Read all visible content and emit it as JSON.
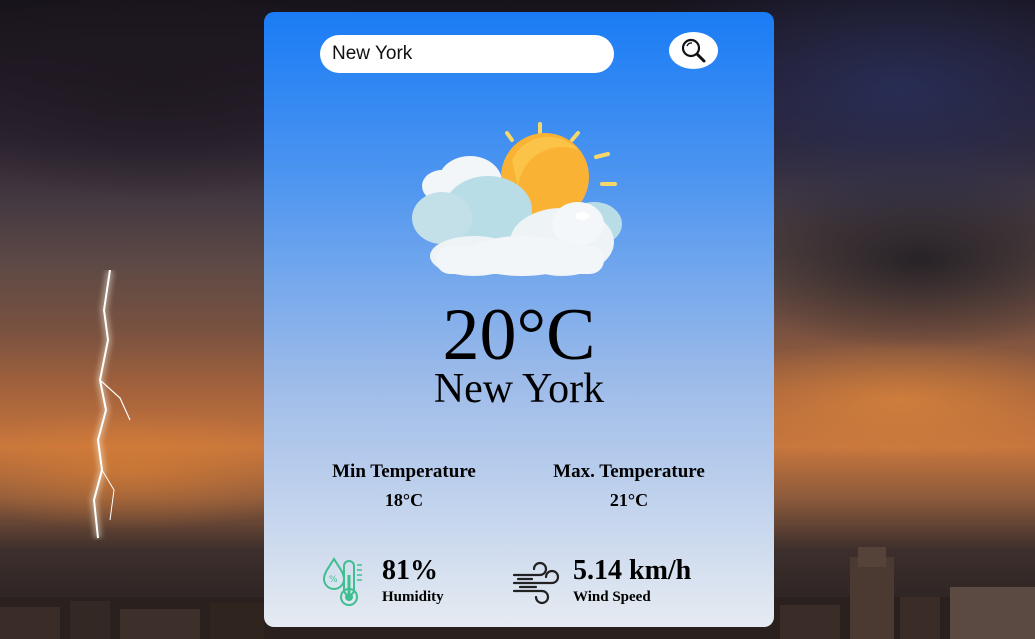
{
  "search": {
    "value": "New York",
    "placeholder": "Enter city name"
  },
  "icons": {
    "search_button": "search-icon",
    "weather": "partly-cloudy-icon",
    "humidity": "humidity-thermometer-icon",
    "wind": "wind-icon",
    "background_lightning": "lightning-bolt"
  },
  "weather": {
    "temperature": "20°C",
    "city": "New York",
    "min_label": "Min Temperature",
    "min_value": "18°C",
    "max_label": "Max. Temperature",
    "max_value": "21°C",
    "humidity_value": "81%",
    "humidity_label": "Humidity",
    "wind_value": "5.14 km/h",
    "wind_label": "Wind Speed"
  },
  "colors": {
    "card_top": "#1a7cf5",
    "card_bottom": "#e6ebf1",
    "sun": "#f9b233",
    "humidity_icon": "#3fbf8f"
  }
}
